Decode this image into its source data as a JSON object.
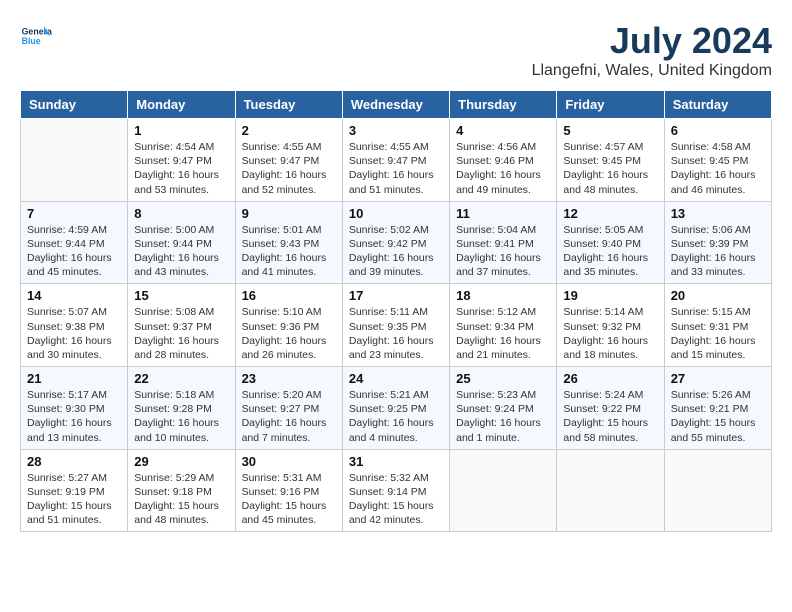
{
  "header": {
    "logo_line1": "General",
    "logo_line2": "Blue",
    "title": "July 2024",
    "subtitle": "Llangefni, Wales, United Kingdom"
  },
  "days_of_week": [
    "Sunday",
    "Monday",
    "Tuesday",
    "Wednesday",
    "Thursday",
    "Friday",
    "Saturday"
  ],
  "weeks": [
    [
      {
        "day": null
      },
      {
        "day": "1",
        "sunrise": "4:54 AM",
        "sunset": "9:47 PM",
        "daylight": "16 hours and 53 minutes."
      },
      {
        "day": "2",
        "sunrise": "4:55 AM",
        "sunset": "9:47 PM",
        "daylight": "16 hours and 52 minutes."
      },
      {
        "day": "3",
        "sunrise": "4:55 AM",
        "sunset": "9:47 PM",
        "daylight": "16 hours and 51 minutes."
      },
      {
        "day": "4",
        "sunrise": "4:56 AM",
        "sunset": "9:46 PM",
        "daylight": "16 hours and 49 minutes."
      },
      {
        "day": "5",
        "sunrise": "4:57 AM",
        "sunset": "9:45 PM",
        "daylight": "16 hours and 48 minutes."
      },
      {
        "day": "6",
        "sunrise": "4:58 AM",
        "sunset": "9:45 PM",
        "daylight": "16 hours and 46 minutes."
      }
    ],
    [
      {
        "day": "7",
        "sunrise": "4:59 AM",
        "sunset": "9:44 PM",
        "daylight": "16 hours and 45 minutes."
      },
      {
        "day": "8",
        "sunrise": "5:00 AM",
        "sunset": "9:44 PM",
        "daylight": "16 hours and 43 minutes."
      },
      {
        "day": "9",
        "sunrise": "5:01 AM",
        "sunset": "9:43 PM",
        "daylight": "16 hours and 41 minutes."
      },
      {
        "day": "10",
        "sunrise": "5:02 AM",
        "sunset": "9:42 PM",
        "daylight": "16 hours and 39 minutes."
      },
      {
        "day": "11",
        "sunrise": "5:04 AM",
        "sunset": "9:41 PM",
        "daylight": "16 hours and 37 minutes."
      },
      {
        "day": "12",
        "sunrise": "5:05 AM",
        "sunset": "9:40 PM",
        "daylight": "16 hours and 35 minutes."
      },
      {
        "day": "13",
        "sunrise": "5:06 AM",
        "sunset": "9:39 PM",
        "daylight": "16 hours and 33 minutes."
      }
    ],
    [
      {
        "day": "14",
        "sunrise": "5:07 AM",
        "sunset": "9:38 PM",
        "daylight": "16 hours and 30 minutes."
      },
      {
        "day": "15",
        "sunrise": "5:08 AM",
        "sunset": "9:37 PM",
        "daylight": "16 hours and 28 minutes."
      },
      {
        "day": "16",
        "sunrise": "5:10 AM",
        "sunset": "9:36 PM",
        "daylight": "16 hours and 26 minutes."
      },
      {
        "day": "17",
        "sunrise": "5:11 AM",
        "sunset": "9:35 PM",
        "daylight": "16 hours and 23 minutes."
      },
      {
        "day": "18",
        "sunrise": "5:12 AM",
        "sunset": "9:34 PM",
        "daylight": "16 hours and 21 minutes."
      },
      {
        "day": "19",
        "sunrise": "5:14 AM",
        "sunset": "9:32 PM",
        "daylight": "16 hours and 18 minutes."
      },
      {
        "day": "20",
        "sunrise": "5:15 AM",
        "sunset": "9:31 PM",
        "daylight": "16 hours and 15 minutes."
      }
    ],
    [
      {
        "day": "21",
        "sunrise": "5:17 AM",
        "sunset": "9:30 PM",
        "daylight": "16 hours and 13 minutes."
      },
      {
        "day": "22",
        "sunrise": "5:18 AM",
        "sunset": "9:28 PM",
        "daylight": "16 hours and 10 minutes."
      },
      {
        "day": "23",
        "sunrise": "5:20 AM",
        "sunset": "9:27 PM",
        "daylight": "16 hours and 7 minutes."
      },
      {
        "day": "24",
        "sunrise": "5:21 AM",
        "sunset": "9:25 PM",
        "daylight": "16 hours and 4 minutes."
      },
      {
        "day": "25",
        "sunrise": "5:23 AM",
        "sunset": "9:24 PM",
        "daylight": "16 hours and 1 minute."
      },
      {
        "day": "26",
        "sunrise": "5:24 AM",
        "sunset": "9:22 PM",
        "daylight": "15 hours and 58 minutes."
      },
      {
        "day": "27",
        "sunrise": "5:26 AM",
        "sunset": "9:21 PM",
        "daylight": "15 hours and 55 minutes."
      }
    ],
    [
      {
        "day": "28",
        "sunrise": "5:27 AM",
        "sunset": "9:19 PM",
        "daylight": "15 hours and 51 minutes."
      },
      {
        "day": "29",
        "sunrise": "5:29 AM",
        "sunset": "9:18 PM",
        "daylight": "15 hours and 48 minutes."
      },
      {
        "day": "30",
        "sunrise": "5:31 AM",
        "sunset": "9:16 PM",
        "daylight": "15 hours and 45 minutes."
      },
      {
        "day": "31",
        "sunrise": "5:32 AM",
        "sunset": "9:14 PM",
        "daylight": "15 hours and 42 minutes."
      },
      {
        "day": null
      },
      {
        "day": null
      },
      {
        "day": null
      }
    ]
  ],
  "labels": {
    "sunrise_prefix": "Sunrise: ",
    "sunset_prefix": "Sunset: ",
    "daylight_prefix": "Daylight: "
  }
}
